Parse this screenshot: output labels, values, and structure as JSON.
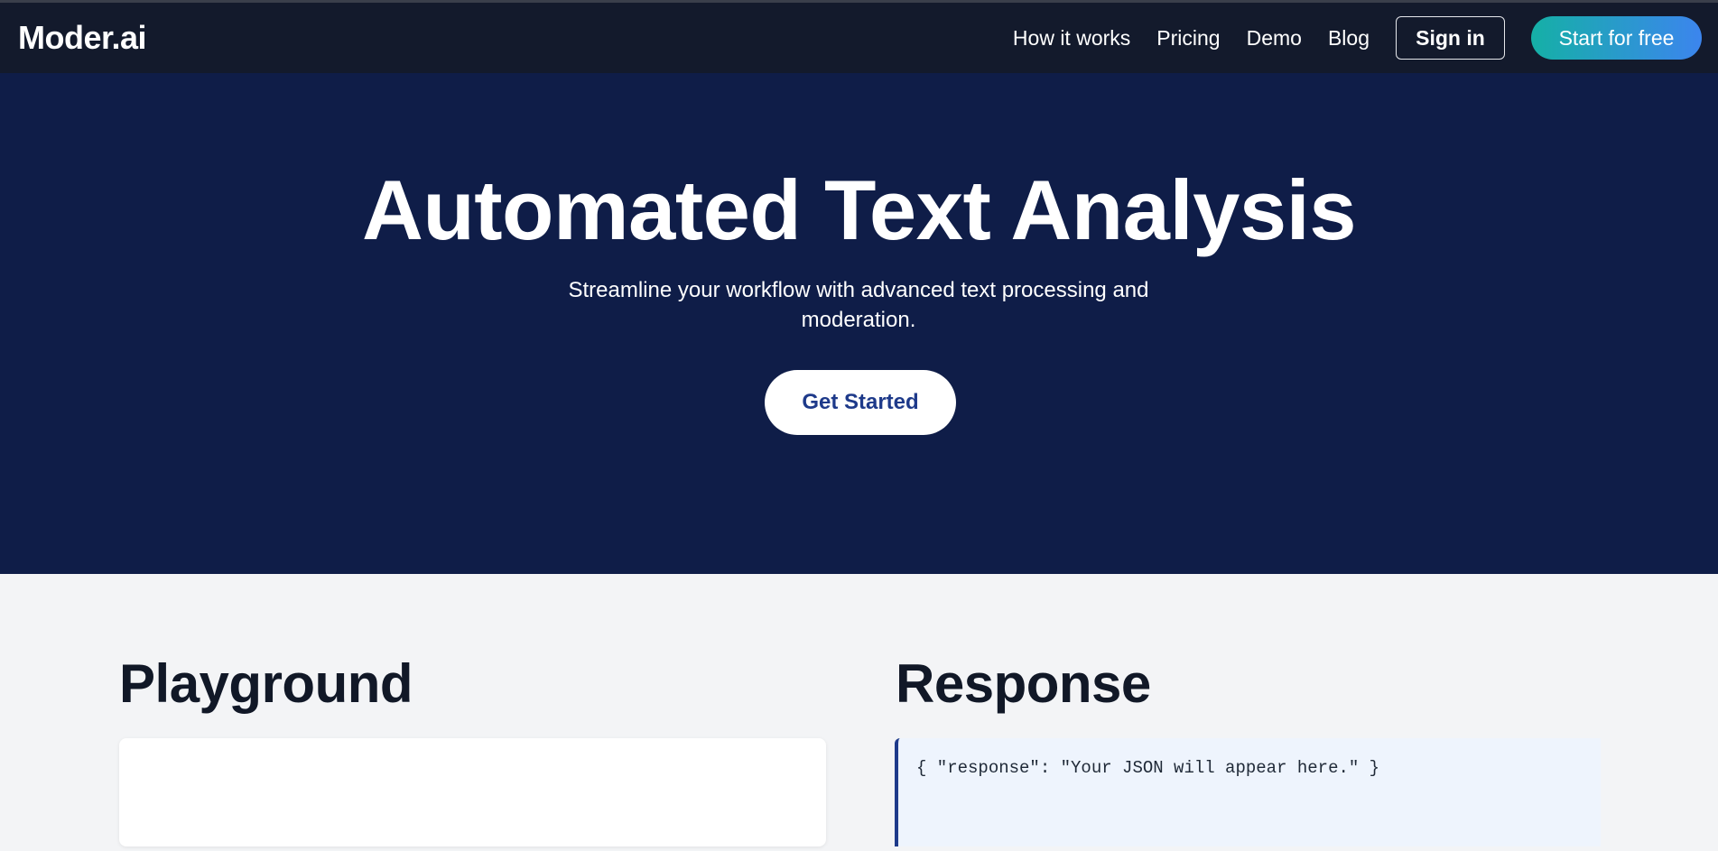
{
  "navbar": {
    "brand": "Moder.ai",
    "links": [
      "How it works",
      "Pricing",
      "Demo",
      "Blog"
    ],
    "signin_label": "Sign in",
    "start_label": "Start for free"
  },
  "hero": {
    "title": "Automated Text Analysis",
    "subtitle": "Streamline your workflow with advanced text processing and moderation.",
    "cta_label": "Get Started"
  },
  "playground": {
    "title": "Playground",
    "input_value": ""
  },
  "response": {
    "title": "Response",
    "output": "{ \"response\": \"Your JSON will appear here.\" }"
  },
  "colors": {
    "navbar_bg": "#131a2c",
    "hero_bg": "#0f1d48",
    "page_bg": "#f3f4f6",
    "accent_start": "#15b0a6",
    "accent_end": "#3c85ee",
    "cta_text": "#1e3a8a",
    "response_bg": "#eef4fd"
  }
}
